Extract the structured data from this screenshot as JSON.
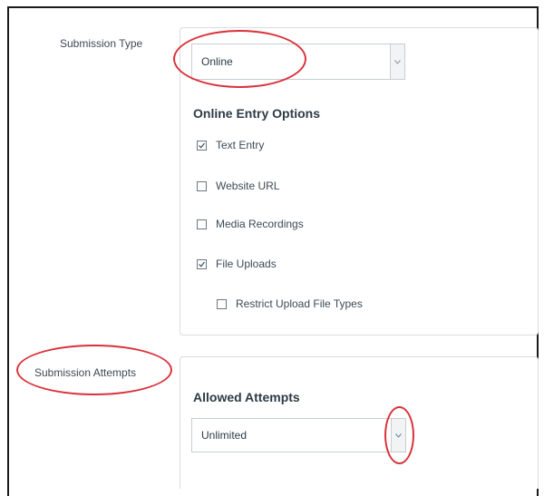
{
  "submission_type": {
    "label": "Submission Type",
    "selected": "Online"
  },
  "online_entry_options": {
    "heading": "Online Entry Options",
    "options": [
      {
        "label": "Text Entry",
        "checked": true
      },
      {
        "label": "Website URL",
        "checked": false
      },
      {
        "label": "Media Recordings",
        "checked": false
      },
      {
        "label": "File Uploads",
        "checked": true
      }
    ],
    "sub_option": {
      "label": "Restrict Upload File Types",
      "checked": false
    }
  },
  "submission_attempts": {
    "label": "Submission Attempts",
    "heading": "Allowed Attempts",
    "selected": "Unlimited"
  },
  "colors": {
    "annotation": "#d9323a",
    "border": "#d9dcdf",
    "text": "#2d3b45"
  },
  "icons": {
    "dropdown": "chevron-down-icon",
    "checked": "checkmark-icon"
  }
}
